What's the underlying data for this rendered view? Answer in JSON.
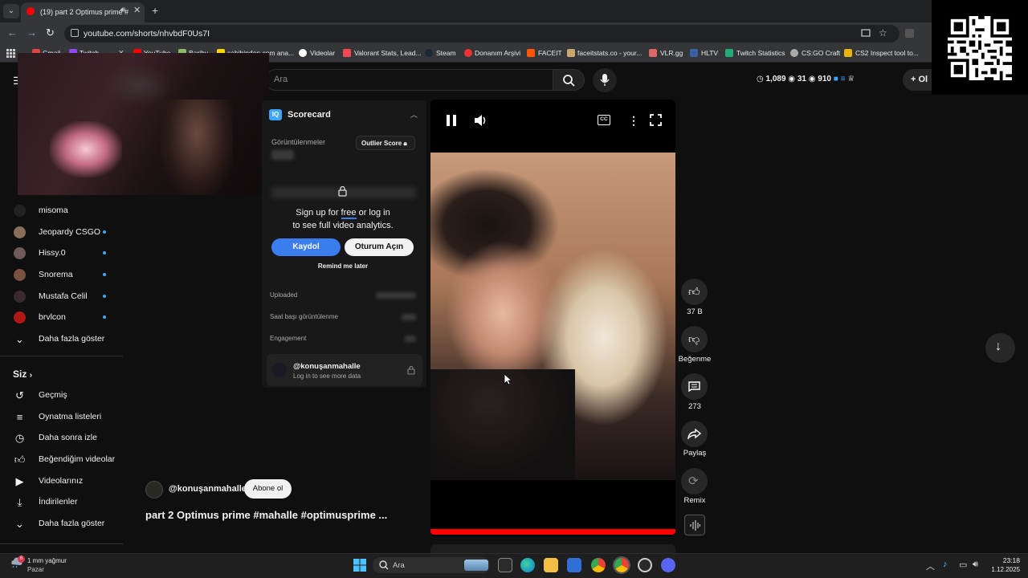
{
  "browser": {
    "tab_title": "(19) part 2 Optimus prime #",
    "url": "youtube.com/shorts/nhvbdF0Us7I",
    "bookmarks": [
      "Gmail",
      "Twitch",
      "X",
      "YouTube",
      "Bariby",
      "sahibinden.com ana...",
      "Videolar",
      "Valorant Stats, Lead...",
      "Steam",
      "Donanım Arşivi",
      "FACEIT",
      "faceitstats.co - your...",
      "VLR.gg",
      "HLTV",
      "Twitch Statistics",
      "CS:GO Craft",
      "CS2 Inspect tool to..."
    ]
  },
  "youtube": {
    "search_placeholder": "Ara",
    "stats": {
      "views": "1,089",
      "a": "31",
      "b": "910"
    },
    "create_label": "Ol"
  },
  "sidebar": {
    "channels": [
      {
        "name": "misoma",
        "live": false,
        "color": "#222222"
      },
      {
        "name": "Jeopardy CSGO",
        "live": true,
        "color": "#8a6e5a"
      },
      {
        "name": "Hissy.0",
        "live": true,
        "color": "#6f5a5a"
      },
      {
        "name": "Snorema",
        "live": true,
        "color": "#7a5240"
      },
      {
        "name": "Mustafa Celil",
        "live": true,
        "color": "#3a2a30"
      },
      {
        "name": "brvlcon",
        "live": true,
        "color": "#b01818"
      }
    ],
    "show_more_1": "Daha fazla göster",
    "you_label": "Siz",
    "you_items": [
      "Geçmiş",
      "Oynatma listeleri",
      "Daha sonra izle",
      "Beğendiğim videolar",
      "Videolarınız",
      "İndirilenler"
    ],
    "show_more_2": "Daha fazla göster"
  },
  "scorecard": {
    "logo": "IQ",
    "title": "Scorecard",
    "views_label": "Görüntülenmeler",
    "outlier_label": "Outlier Score",
    "signup_line1_pre": "Sign up for ",
    "signup_free": "free",
    "signup_line1_post": " or log in",
    "signup_line2": "to see full video analytics.",
    "signup_button": "Kaydol",
    "login_button": "Oturum Açın",
    "remind_label": "Remind me later",
    "rows": [
      "Uploaded",
      "Saat başı görüntülenme",
      "Engagement"
    ],
    "channel_handle": "@konuşanmahalle",
    "channel_sub": "Log in to see more data"
  },
  "video": {
    "likes": "37 B",
    "dislike_label": "Beğenme",
    "comments": "273",
    "share_label": "Paylaş",
    "remix_label": "Remix",
    "channel": "@konuşanmahalle",
    "subscribe_label": "Abone ol",
    "title": "part 2 Optimus prime #mahalle #optimusprime ...",
    "progress": 1.0
  },
  "taskbar": {
    "weather_temp": "1 mm yağmur",
    "weather_day": "Pazar",
    "weather_badge": "6",
    "search_text": "Ara",
    "time": "23:18",
    "date": "1.12.2025"
  }
}
